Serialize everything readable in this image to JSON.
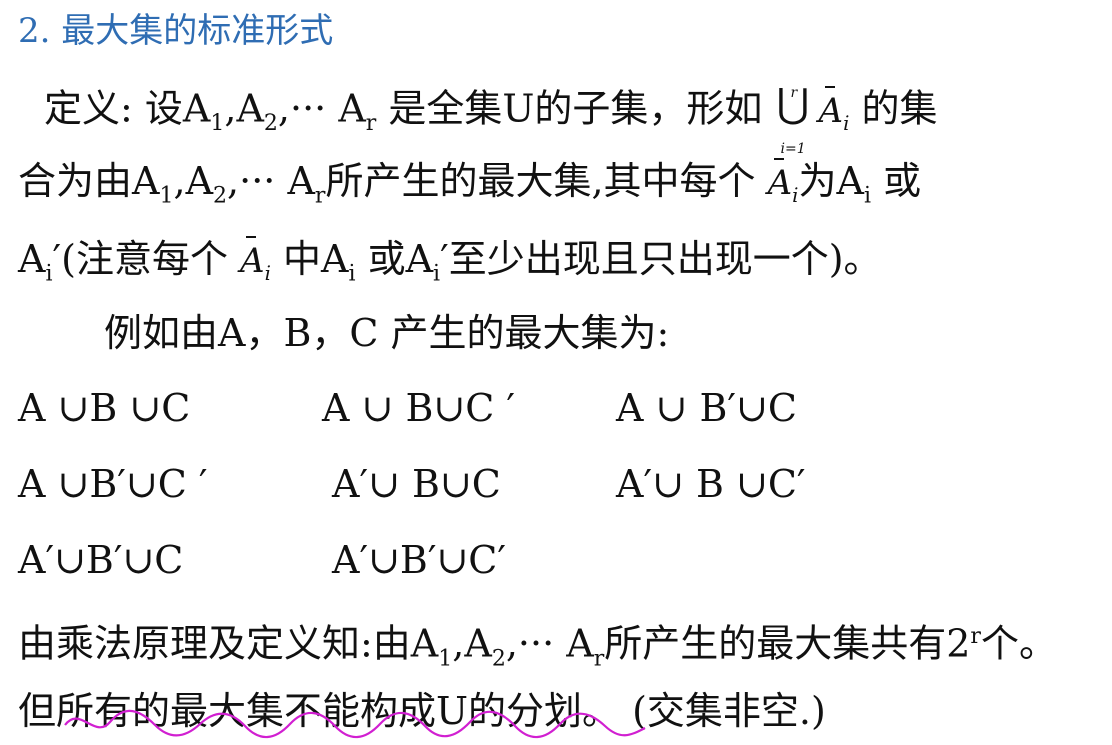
{
  "heading": "2.  最大集的标准形式",
  "def": {
    "p1a": "定义: 设A",
    "s1": "1",
    "c1": ",A",
    "s2": "2",
    "c2": ",··· A",
    "sr": "r",
    "p1b": " 是全集U的子集，形如",
    "union_top": "r",
    "union_sym": "⋃",
    "union_bot": "i=1",
    "ai": "A",
    "ai_sub": "i",
    "p1c": " 的集",
    "p2a": "合为由A",
    "p2s1": "1",
    "p2c1": ",A",
    "p2s2": "2",
    "p2c2": ",··· A",
    "p2sr": "r",
    "p2b": "所产生的最大集,其中每个 ",
    "p2c": "为A",
    "p2si": "i",
    "p2d": " 或",
    "p3a": "A",
    "p3si": "i",
    "p3b": "′(注意每个 ",
    "p3c": " 中A",
    "p3si2": "i",
    "p3d": " 或A",
    "p3si3": "i",
    "p3e": "′至少出现且只出现一个)。"
  },
  "example_intro": "例如由A，B，C   产生的最大集为:",
  "sets": [
    [
      "A ∪B ∪C",
      "A ∪ B∪C ′",
      "A ∪  B′∪C"
    ],
    [
      "A ∪B′∪C  ′",
      "A′∪ B∪C",
      "A′∪  B ∪C′"
    ],
    [
      "A′∪B′∪C",
      "A′∪B′∪C′"
    ]
  ],
  "mult": {
    "a": "由乘法原理及定义知:由A",
    "s1": "1",
    "c1": ",A",
    "s2": "2",
    "c2": ",··· A",
    "sr": "r",
    "b": "所产生的最大集共有2",
    "sup": "r",
    "c": "个。"
  },
  "last_line": "但所有的最大集不能构成U的分划。 (交集非空.)",
  "colors": {
    "heading": "#2f6db3",
    "text": "#111111",
    "squiggle": "#d11fd1"
  }
}
